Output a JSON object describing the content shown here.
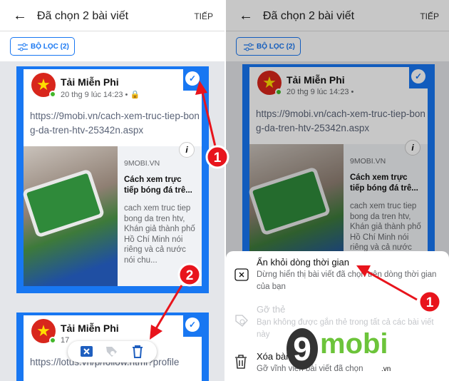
{
  "header": {
    "title": "Đã chọn 2 bài viết",
    "next_label": "TIẾP",
    "filter_label": "BỘ LỌC (2)"
  },
  "posts": [
    {
      "author": "Tải Miễn Phi",
      "date": "20 thg 9 lúc 14:23 •",
      "link": "https://9mobi.vn/cach-xem-truc-tiep-bong-da-tren-htv-25342n.aspx",
      "preview": {
        "source": "9MOBI.VN",
        "title": "Cách xem trực tiếp bóng đá trê...",
        "description": "cach xem truc tiep bong da tren htv, Khán giả thành phố Hồ Chí Minh nói riêng và cả nước nói chu..."
      }
    },
    {
      "author": "Tải Miễn Phi",
      "date": "17",
      "link": "https://lotus.vn/p/follow.html?profile"
    }
  ],
  "menu": [
    {
      "label": "Ẩn khỏi dòng thời gian",
      "description": "Dừng hiển thị bài viết đã chọn trên dòng thời gian của bạn",
      "icon": "hide-x-icon"
    },
    {
      "label": "Gỡ thẻ",
      "description": "Bạn không được gắn thẻ trong tất cả các bài viết này",
      "icon": "tag-icon",
      "disabled": true
    },
    {
      "label": "Xóa bài",
      "description": "Gỡ vĩnh viễn bài viết đã chọn",
      "icon": "trash-icon"
    }
  ],
  "annotations": {
    "step1": "1",
    "step2": "2",
    "step1b": "1"
  },
  "watermark": {
    "text": "9mobi",
    ".vn": ".vn"
  },
  "colors": {
    "accent": "#1877f2",
    "annotation": "#e8141c"
  }
}
